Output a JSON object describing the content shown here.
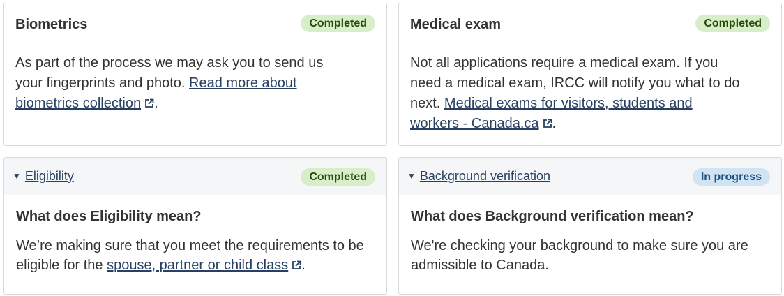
{
  "cards": {
    "biometrics": {
      "title": "Biometrics",
      "status": "Completed",
      "text_before": "As part of the process we may ask you to send us your fingerprints and photo. ",
      "link": "Read more about biometrics collection",
      "text_after": "."
    },
    "medical": {
      "title": "Medical exam",
      "status": "Completed",
      "text_before": "Not all applications require a medical exam. If you need a medical exam, IRCC will notify you what to do next. ",
      "link": "Medical exams for visitors, students and workers - Canada.ca",
      "text_after": "."
    }
  },
  "panels": {
    "eligibility": {
      "toggle": "Eligibility",
      "status": "Completed",
      "question": "What does Eligibility mean?",
      "text_before": "We’re making sure that you meet the requirements to be eligible for the ",
      "link": "spouse, partner or child class",
      "text_after": "."
    },
    "background": {
      "toggle": "Background verification",
      "status": "In progress",
      "question": "What does Background verification mean?",
      "text": "We're checking your background to make sure you are admissible to Canada."
    }
  },
  "icons": {
    "external_link": "external-link-icon",
    "caret": "caret-down-icon"
  },
  "colors": {
    "completed_bg": "#d8eeca",
    "completed_text": "#254b07",
    "progress_bg": "#d1e4f3",
    "progress_text": "#1d4e82",
    "link": "#284162"
  }
}
